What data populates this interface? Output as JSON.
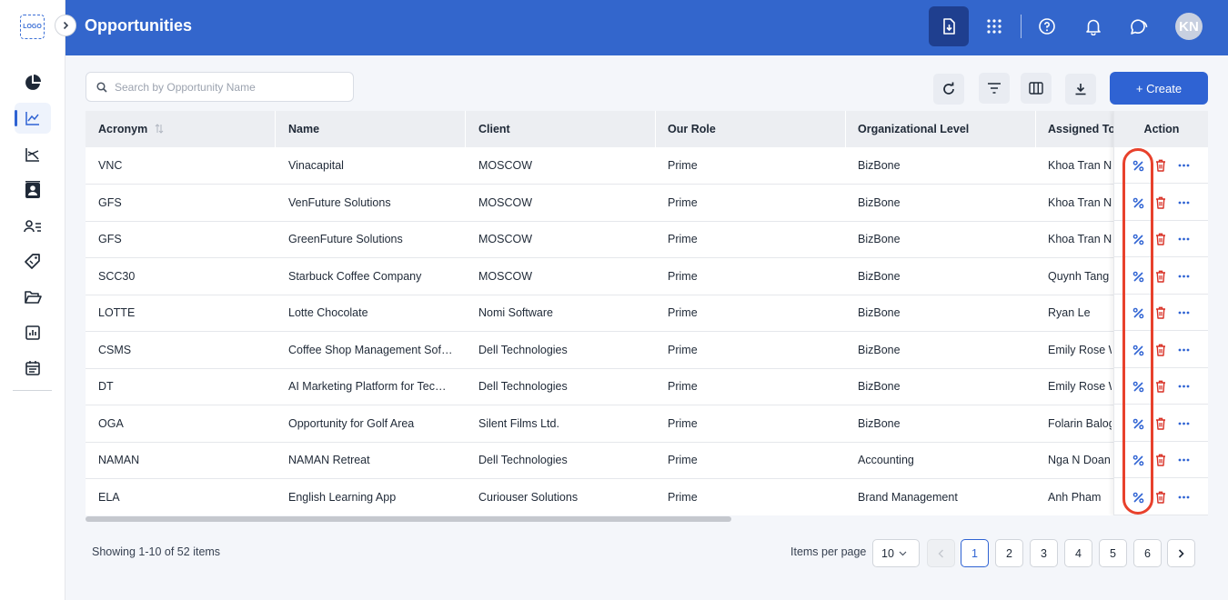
{
  "app": {
    "logo_text": "LOGO",
    "page_title": "Opportunities",
    "user_initials": "KN"
  },
  "colors": {
    "header": "#3366cc",
    "primary": "#2f63d3",
    "delete": "#d93025",
    "highlight": "#e8412c"
  },
  "sidebar": {
    "items": [
      {
        "icon": "pie-chart-icon"
      },
      {
        "icon": "line-chart-icon",
        "active": true
      },
      {
        "icon": "trend-chart-icon"
      },
      {
        "icon": "contact-card-icon"
      },
      {
        "icon": "user-list-icon"
      },
      {
        "icon": "tag-icon"
      },
      {
        "icon": "folder-open-icon"
      },
      {
        "icon": "bar-report-icon"
      },
      {
        "icon": "calendar-icon"
      }
    ]
  },
  "header": {
    "actions": [
      "import-export-icon",
      "apps-grid-icon",
      "help-icon",
      "bell-icon",
      "chat-icon"
    ]
  },
  "toolbar": {
    "search_placeholder": "Search by Opportunity Name",
    "search_value": "",
    "create_label": "+ Create"
  },
  "table": {
    "columns": [
      "Acronym",
      "Name",
      "Client",
      "Our Role",
      "Organizational Level",
      "Assigned To",
      "Action"
    ],
    "rows": [
      [
        "VNC",
        "Vinacapital",
        "MOSCOW",
        "Prime",
        "BizBone",
        "Khoa Tran Ngoc"
      ],
      [
        "GFS",
        "VenFuture Solutions",
        "MOSCOW",
        "Prime",
        "BizBone",
        "Khoa Tran Ngoc"
      ],
      [
        "GFS",
        "GreenFuture Solutions",
        "MOSCOW",
        "Prime",
        "BizBone",
        "Khoa Tran Ngoc"
      ],
      [
        "SCC30",
        "Starbuck Coffee Company",
        "MOSCOW",
        "Prime",
        "BizBone",
        "Quynh Tang"
      ],
      [
        "LOTTE",
        "Lotte Chocolate",
        "Nomi Software",
        "Prime",
        "BizBone",
        "Ryan Le"
      ],
      [
        "CSMS",
        "Coffee Shop Management Sof…",
        "Dell Technologies",
        "Prime",
        "BizBone",
        "Emily Rose W"
      ],
      [
        "DT",
        "AI Marketing Platform for Tec…",
        "Dell Technologies",
        "Prime",
        "BizBone",
        "Emily Rose W"
      ],
      [
        "OGA",
        "Opportunity for Golf Area",
        "Silent Films Ltd.",
        "Prime",
        "BizBone",
        "Folarin Balog"
      ],
      [
        "NAMAN",
        "NAMAN Retreat",
        "Dell Technologies",
        "Prime",
        "Accounting",
        "Nga N Doan"
      ],
      [
        "ELA",
        "English Learning App",
        "Curiouser Solutions",
        "Prime",
        "Brand Management",
        "Anh Pham"
      ]
    ]
  },
  "footer": {
    "showing": "Showing 1-10 of 52 items",
    "items_per_page_label": "Items per page",
    "items_per_page": "10",
    "pages": [
      "1",
      "2",
      "3",
      "4",
      "5",
      "6"
    ],
    "current_page": "1"
  }
}
